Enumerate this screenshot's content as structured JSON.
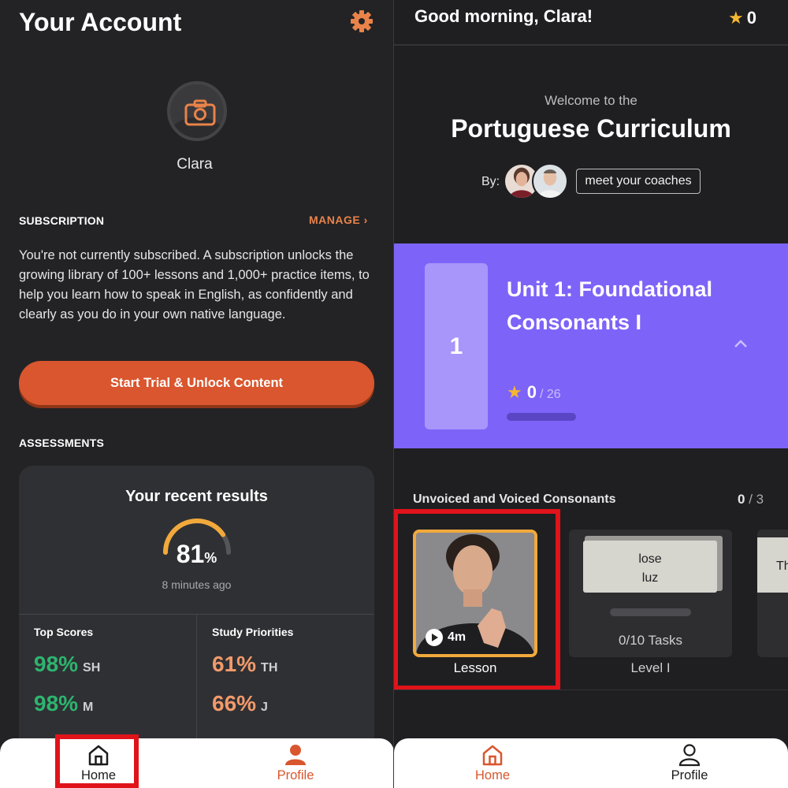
{
  "account": {
    "title": "Your Account",
    "username": "Clara",
    "subscription_label": "SUBSCRIPTION",
    "manage_label": "MANAGE",
    "subscription_text": "You're not currently subscribed. A subscription unlocks the growing library of 100+ lessons and 1,000+ practice items, to help you learn how to speak in English, as confidently and clearly as you do in your own native language.",
    "trial_button": "Start Trial & Unlock Content",
    "assessments_label": "ASSESSMENTS",
    "results": {
      "title": "Your recent results",
      "score": "81",
      "score_unit": "%",
      "score_fraction": 0.81,
      "time_ago": "8 minutes ago",
      "top_scores_title": "Top Scores",
      "study_priorities_title": "Study Priorities",
      "top_scores": [
        {
          "value": "98%",
          "sound": "SH"
        },
        {
          "value": "98%",
          "sound": "M"
        }
      ],
      "study_priorities": [
        {
          "value": "61%",
          "sound": "TH"
        },
        {
          "value": "66%",
          "sound": "J"
        }
      ]
    }
  },
  "bottom_nav_left": {
    "home": "Home",
    "profile": "Profile"
  },
  "home": {
    "greeting": "Good morning, Clara!",
    "stars": "0",
    "welcome": "Welcome to the",
    "curriculum_title": "Portuguese Curriculum",
    "by_label": "By:",
    "meet_coaches": "meet your coaches",
    "unit": {
      "number": "1",
      "title": "Unit 1: Foundational Consonants I",
      "stars": "0",
      "stars_total": "/ 26"
    },
    "group": {
      "title": "Unvoiced and Voiced Consonants",
      "count_done": "0",
      "count_total": "/ 3"
    },
    "lesson_card": {
      "duration": "4m",
      "label": "Lesson"
    },
    "level_card": {
      "word1": "lose",
      "word2": "luz",
      "tasks": "0/10 Tasks",
      "label": "Level I"
    },
    "third_card_peek": "Th"
  },
  "bottom_nav_right": {
    "home": "Home",
    "profile": "Profile"
  },
  "colors": {
    "accent_orange": "#d9562e",
    "purple": "#7e63f8",
    "highlight_red": "#e0131a",
    "star_gold": "#f5b731"
  }
}
